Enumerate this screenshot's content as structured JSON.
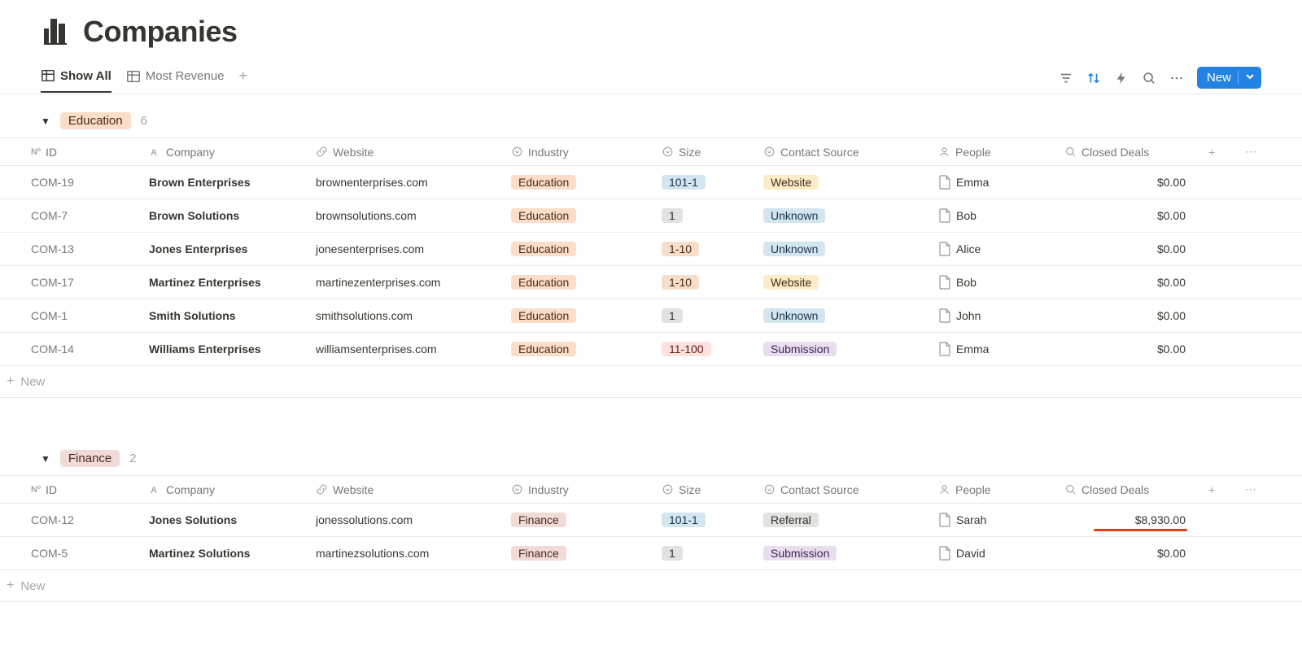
{
  "header": {
    "title": "Companies"
  },
  "views": {
    "tabs": [
      {
        "label": "Show All",
        "active": true
      },
      {
        "label": "Most Revenue",
        "active": false
      }
    ]
  },
  "toolbar": {
    "new_label": "New"
  },
  "columns": {
    "id": "ID",
    "company": "Company",
    "website": "Website",
    "industry": "Industry",
    "size": "Size",
    "contact_source": "Contact Source",
    "people": "People",
    "closed_deals": "Closed Deals"
  },
  "groups": [
    {
      "name": "Education",
      "tag_class": "tag-education",
      "count": "6",
      "rows": [
        {
          "id": "COM-19",
          "company": "Brown Enterprises",
          "website": "brownenterprises.com",
          "industry": "Education",
          "industry_class": "tag-education",
          "size": "101-1",
          "size_class": "tag-size-blue",
          "source": "Website",
          "source_class": "tag-src-website",
          "person": "Emma",
          "deals": "$0.00"
        },
        {
          "id": "COM-7",
          "company": "Brown Solutions",
          "website": "brownsolutions.com",
          "industry": "Education",
          "industry_class": "tag-education",
          "size": "1",
          "size_class": "tag-size-gray",
          "source": "Unknown",
          "source_class": "tag-src-unknown",
          "person": "Bob",
          "deals": "$0.00"
        },
        {
          "id": "COM-13",
          "company": "Jones Enterprises",
          "website": "jonesenterprises.com",
          "industry": "Education",
          "industry_class": "tag-education",
          "size": "1-10",
          "size_class": "tag-size-peach",
          "source": "Unknown",
          "source_class": "tag-src-unknown",
          "person": "Alice",
          "deals": "$0.00"
        },
        {
          "id": "COM-17",
          "company": "Martinez Enterprises",
          "website": "martinezenterprises.com",
          "industry": "Education",
          "industry_class": "tag-education",
          "size": "1-10",
          "size_class": "tag-size-peach",
          "source": "Website",
          "source_class": "tag-src-website",
          "person": "Bob",
          "deals": "$0.00"
        },
        {
          "id": "COM-1",
          "company": "Smith Solutions",
          "website": "smithsolutions.com",
          "industry": "Education",
          "industry_class": "tag-education",
          "size": "1",
          "size_class": "tag-size-gray",
          "source": "Unknown",
          "source_class": "tag-src-unknown",
          "person": "John",
          "deals": "$0.00"
        },
        {
          "id": "COM-14",
          "company": "Williams Enterprises",
          "website": "williamsenterprises.com",
          "industry": "Education",
          "industry_class": "tag-education",
          "size": "11-100",
          "size_class": "tag-size-red",
          "source": "Submission",
          "source_class": "tag-src-submission",
          "person": "Emma",
          "deals": "$0.00"
        }
      ]
    },
    {
      "name": "Finance",
      "tag_class": "tag-finance",
      "count": "2",
      "rows": [
        {
          "id": "COM-12",
          "company": "Jones Solutions",
          "website": "jonessolutions.com",
          "industry": "Finance",
          "industry_class": "tag-finance",
          "size": "101-1",
          "size_class": "tag-size-blue",
          "source": "Referral",
          "source_class": "tag-src-referral",
          "person": "Sarah",
          "deals": "$8,930.00",
          "highlight": true
        },
        {
          "id": "COM-5",
          "company": "Martinez Solutions",
          "website": "martinezsolutions.com",
          "industry": "Finance",
          "industry_class": "tag-finance",
          "size": "1",
          "size_class": "tag-size-gray",
          "source": "Submission",
          "source_class": "tag-src-submission",
          "person": "David",
          "deals": "$0.00"
        }
      ]
    }
  ],
  "new_row_label": "New"
}
